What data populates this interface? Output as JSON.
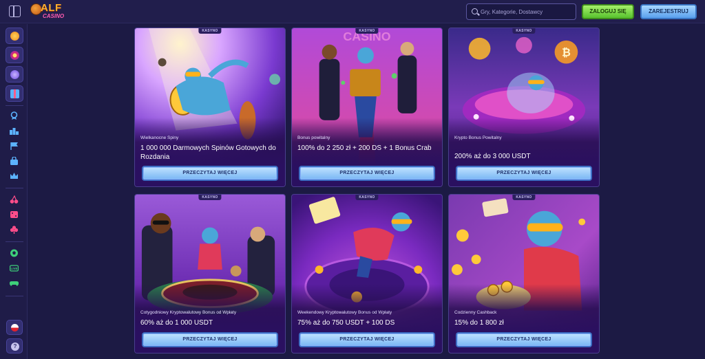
{
  "header": {
    "brand_top": "ALF",
    "brand_bottom": "CASINO",
    "search_placeholder": "Gry, Kategorie, Dostawcy",
    "login_label": "ZALOGUJ SIĘ",
    "register_label": "ZAREJESTRUJ"
  },
  "sidebar": {
    "top_icons": [
      "chip-icon",
      "wheel-icon",
      "gem-icon",
      "gift-icon"
    ],
    "group1_icons": [
      "medal-icon",
      "podium-icon",
      "flag-icon",
      "bag-icon",
      "crown-icon"
    ],
    "group2_icons": [
      "cherry-icon",
      "dice-icon",
      "clover-icon"
    ],
    "group3_icons": [
      "soccer-icon",
      "live-icon",
      "gamepad-icon"
    ],
    "language": "pl-flag-icon",
    "help_symbol": "?"
  },
  "cards": [
    {
      "tag": "KASYNO",
      "category": "Wielkanocne Spiny",
      "title": "1 000 000 Darmowych Spinów Gotowych do Rozdania",
      "button": "PRZECZYTAJ WIĘCEJ"
    },
    {
      "tag": "KASYNO",
      "category": "Bonus powitalny",
      "title": "100% do 2 250 zł + 200 DS + 1 Bonus Crab",
      "button": "PRZECZYTAJ WIĘCEJ"
    },
    {
      "tag": "KASYNO",
      "category": "Krypto Bonus Powitalny",
      "title": "200% aż do 3 000 USDT",
      "button": "PRZECZYTAJ WIĘCEJ"
    },
    {
      "tag": "KASYNO",
      "category": "Cotygodniowy Kryptowalutowy Bonus od Wpłaty",
      "title": "60% aż do 1 000 USDT",
      "button": "PRZECZYTAJ WIĘCEJ"
    },
    {
      "tag": "KASYNO",
      "category": "Weekendowy Kryptowalutowy Bonus od Wpłaty",
      "title": "75% aż do 750 USDT + 100 DS",
      "button": "PRZECZYTAJ WIĘCEJ"
    },
    {
      "tag": "KASYNO",
      "category": "Codzienny Cashback",
      "title": "15% do 1 800 zł",
      "button": "PRZECZYTAJ WIĘCEJ"
    }
  ],
  "colors": {
    "background": "#1c1a44",
    "login_green": "#58c22e",
    "register_blue": "#5aa0ee",
    "card_button": "#79b6f4"
  }
}
